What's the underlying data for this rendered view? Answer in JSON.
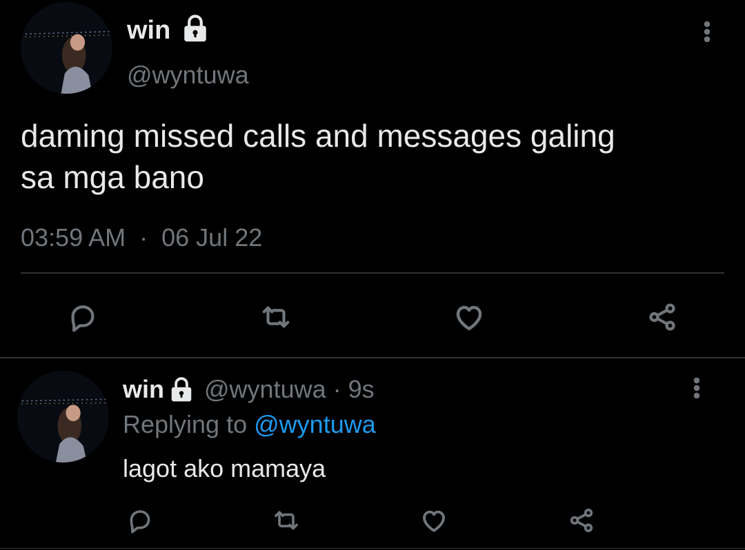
{
  "main_tweet": {
    "display_name": "win",
    "handle": "@wyntuwa",
    "text_line1": "daming missed calls and messages galing",
    "text_line2": "sa mga bano",
    "time": "03:59 AM",
    "separator": "·",
    "date": "06 Jul 22",
    "locked_icon": "lock-icon",
    "actions": [
      "reply-icon",
      "retweet-icon",
      "like-icon",
      "share-icon"
    ]
  },
  "reply_tweet": {
    "display_name": "win",
    "handle": "@wyntuwa",
    "separator": "·",
    "age": "9s",
    "replying_prefix": "Replying to",
    "replying_to": "@wyntuwa",
    "text": "lagot ako mamaya",
    "locked_icon": "lock-icon",
    "actions": [
      "reply-icon",
      "retweet-icon",
      "like-icon",
      "share-icon"
    ]
  },
  "colors": {
    "background": "#000000",
    "text": "#e7e9ea",
    "muted": "#71767b",
    "link": "#1d9bf0",
    "divider": "#2f3336"
  }
}
